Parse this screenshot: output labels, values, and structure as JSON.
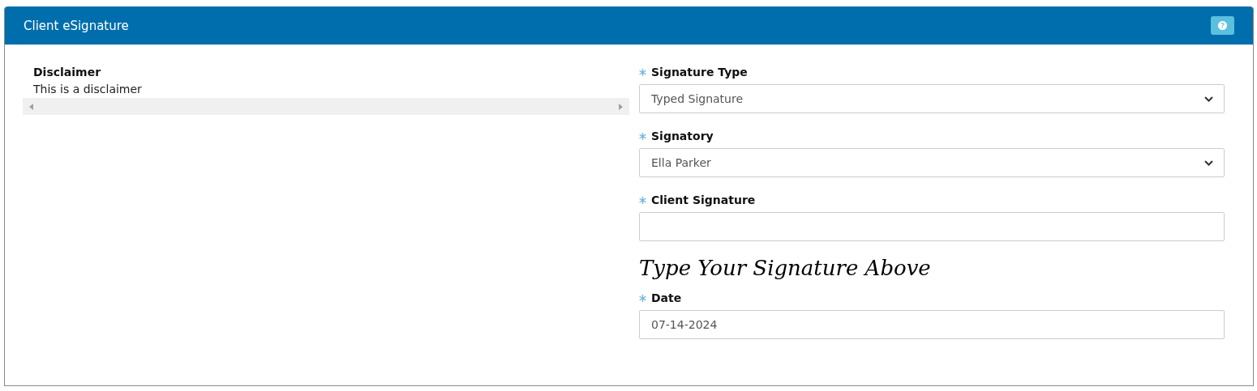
{
  "panel": {
    "title": "Client eSignature",
    "help_icon": "?"
  },
  "disclaimer": {
    "title": "Disclaimer",
    "text": "This is a disclaimer"
  },
  "fields": [
    {
      "label": "Signature Type",
      "required": true,
      "kind": "select",
      "value": "Typed Signature"
    },
    {
      "label": "Signatory",
      "required": true,
      "kind": "select",
      "value": "Ella Parker"
    },
    {
      "label": "Client Signature",
      "required": true,
      "kind": "text",
      "hint": "Type Your Signature Above"
    },
    {
      "label": "Date",
      "required": true,
      "kind": "text",
      "value": "07-14-2024"
    }
  ]
}
